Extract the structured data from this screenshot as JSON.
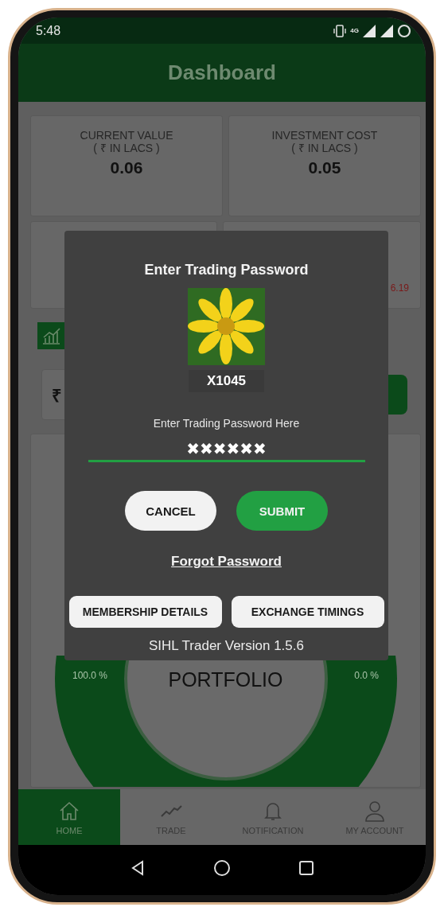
{
  "status_bar": {
    "time": "5:48",
    "network": "4G"
  },
  "app_bar": {
    "title": "Dashboard"
  },
  "summary_cards": [
    {
      "label": "CURRENT VALUE",
      "unit": "( ₹ IN LACS )",
      "value": "0.06"
    },
    {
      "label": "INVESTMENT COST",
      "unit": "( ₹ IN LACS )",
      "value": "0.05"
    }
  ],
  "change_card": {
    "value": "6.19"
  },
  "amount_field": {
    "symbol": "₹"
  },
  "portfolio": {
    "center_label": "PORTFOLIO",
    "left_label": "100.0 %",
    "right_label": "0.0 %"
  },
  "dialog": {
    "title": "Enter Trading Password",
    "user_id": "X1045",
    "field_label": "Enter Trading Password Here",
    "password": "✖✖✖✖✖✖",
    "buttons": [
      {
        "label": "CANCEL",
        "kind": "secondary"
      },
      {
        "label": "SUBMIT",
        "kind": "primary"
      }
    ],
    "link": "Forgot Password",
    "info_buttons": [
      "MEMBERSHIP DETAILS",
      "EXCHANGE TIMINGS"
    ],
    "version": "SIHL Trader Version 1.5.6"
  },
  "bottom_nav": [
    {
      "label": "HOME",
      "kind": "home",
      "selected": true
    },
    {
      "label": "TRADE",
      "kind": "trade",
      "selected": false
    },
    {
      "label": "NOTIFICATION",
      "kind": "bell",
      "selected": false
    },
    {
      "label": "MY ACCOUNT",
      "kind": "person",
      "selected": false
    }
  ]
}
